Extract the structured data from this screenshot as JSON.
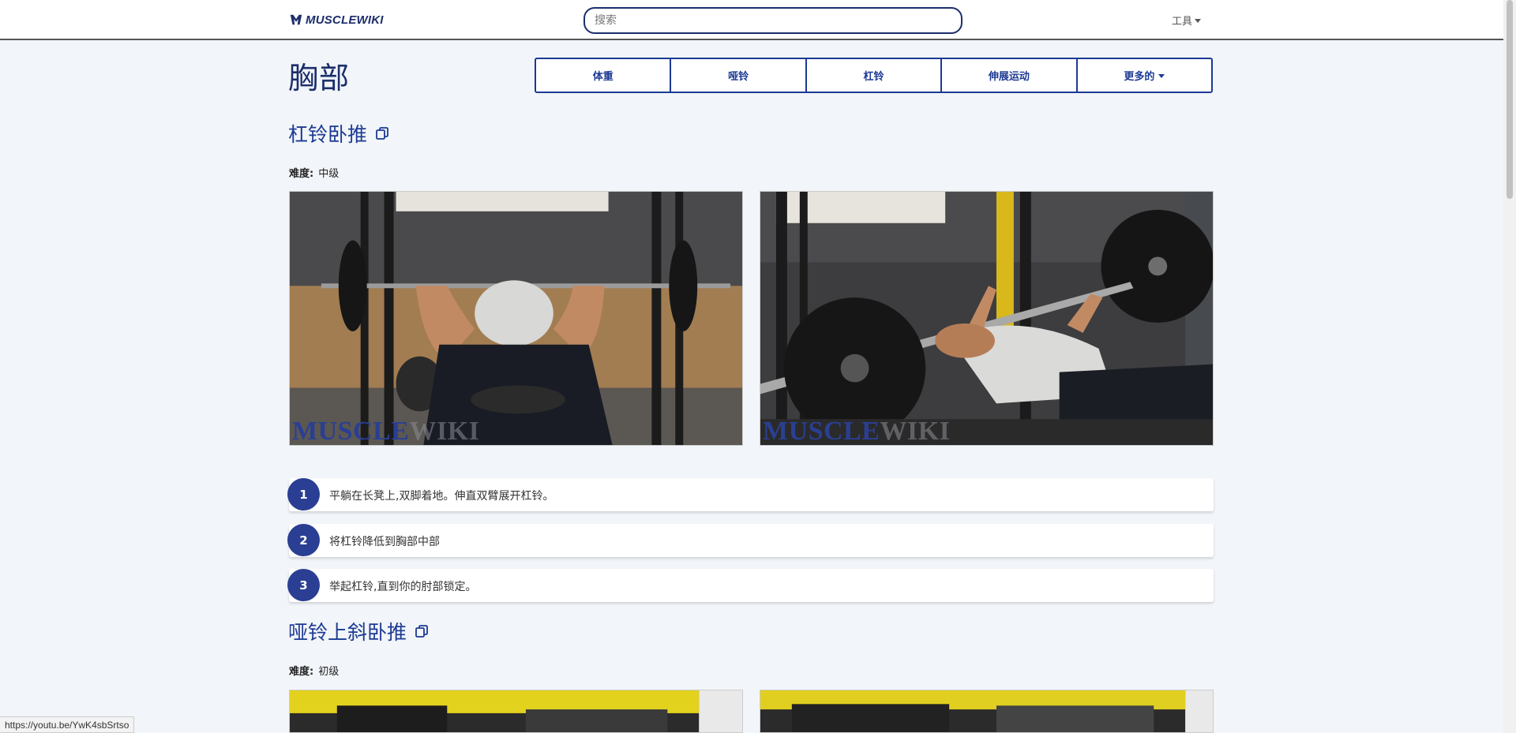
{
  "header": {
    "logo_text": "MUSCLEWIKI",
    "search_placeholder": "搜索",
    "search_value": "",
    "tools_label": "工具"
  },
  "page": {
    "title": "胸部",
    "tabs": [
      {
        "label": "体重"
      },
      {
        "label": "哑铃"
      },
      {
        "label": "杠铃"
      },
      {
        "label": "伸展运动"
      },
      {
        "label": "更多的"
      }
    ]
  },
  "exercises": [
    {
      "title": "杠铃卧推",
      "difficulty_label": "难度:",
      "difficulty": "中级",
      "watermark_a": "MUSCLE",
      "watermark_b": "WIKI",
      "steps": [
        {
          "num": "1",
          "text": "平躺在长凳上,双脚着地。伸直双臂展开杠铃。"
        },
        {
          "num": "2",
          "text": "将杠铃降低到胸部中部"
        },
        {
          "num": "3",
          "text": "举起杠铃,直到你的肘部锁定。"
        }
      ]
    },
    {
      "title": "哑铃上斜卧推",
      "difficulty_label": "难度:",
      "difficulty": "初级"
    }
  ],
  "status_url": "https://youtu.be/YwK4sbSrtso",
  "colors": {
    "brand": "#1c2e6b",
    "accent": "#2a3f93",
    "background": "#f2f5f9"
  },
  "icons": [
    "musclewiki-logo-icon",
    "copy-icon",
    "chevron-down-icon"
  ]
}
